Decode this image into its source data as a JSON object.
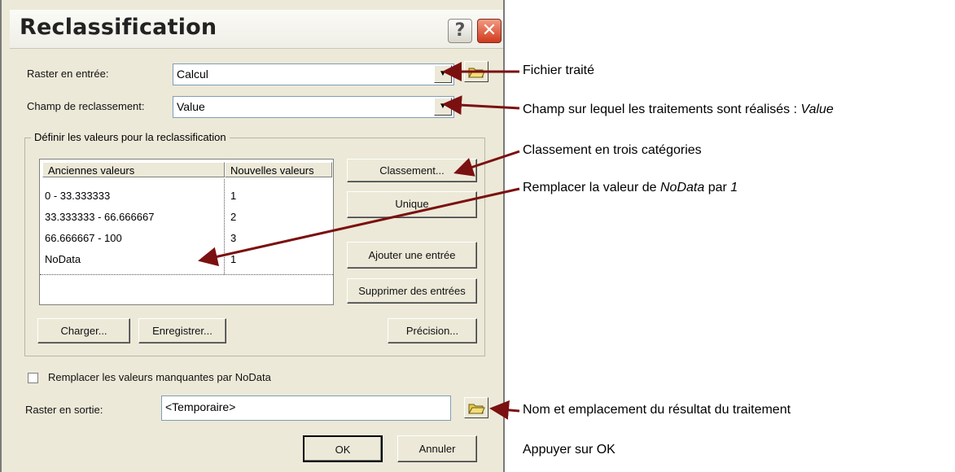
{
  "window": {
    "title": "Reclassification",
    "help_label": "?",
    "close_label": "✕"
  },
  "input": {
    "raster_label": "Raster en entrée:",
    "raster_value": "Calcul",
    "field_label": "Champ de reclassement:",
    "field_value": "Value"
  },
  "group": {
    "label": "Définir les valeurs pour la reclassification"
  },
  "table": {
    "columns": [
      "Anciennes valeurs",
      "Nouvelles valeurs"
    ],
    "rows": [
      [
        "0 - 33.333333",
        "1"
      ],
      [
        "33.333333 - 66.666667",
        "2"
      ],
      [
        "66.666667 - 100",
        "3"
      ],
      [
        "NoData",
        "1"
      ]
    ]
  },
  "buttons": {
    "classement": "Classement...",
    "unique": "Unique",
    "ajouter": "Ajouter une entrée",
    "supprimer": "Supprimer des entrées",
    "charger": "Charger...",
    "enregistrer": "Enregistrer...",
    "precision": "Précision...",
    "ok": "OK",
    "annuler": "Annuler"
  },
  "options": {
    "missing_label": "Remplacer les valeurs manquantes par NoData",
    "missing_checked": false
  },
  "output": {
    "raster_label": "Raster en sortie:",
    "raster_value": "<Temporaire>"
  },
  "annotations": {
    "fichier": "Fichier traité",
    "champ": "Champ sur lequel les traitements sont réalisés :",
    "champ_value": "Value",
    "classement": "Classement en trois catégories",
    "nodata_pre": "Remplacer la valeur de",
    "nodata_word": "NoData",
    "nodata_mid": "par",
    "nodata_val": "1",
    "sortie": "Nom et emplacement du résultat du traitement",
    "ok": "Appuyer sur OK"
  },
  "colors": {
    "arrow": "#7b1010",
    "dialog_bg": "#ece9d8"
  }
}
